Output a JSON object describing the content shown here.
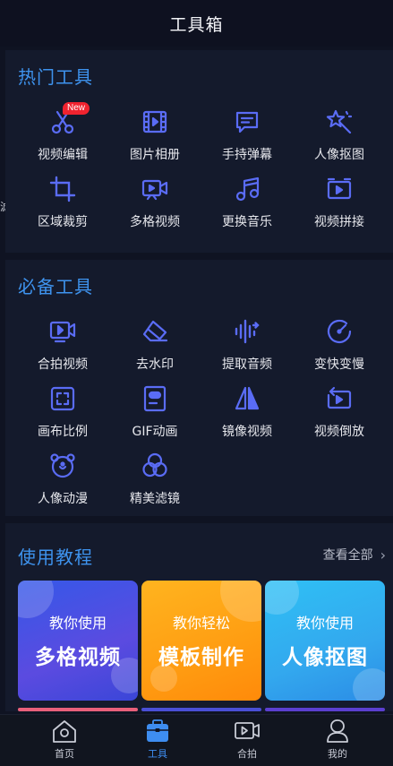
{
  "header": {
    "title": "工具箱"
  },
  "hot": {
    "title": "热门工具",
    "badge": "New",
    "items": [
      {
        "label": "视频编辑",
        "icon": "scissors-icon"
      },
      {
        "label": "图片相册",
        "icon": "film-icon"
      },
      {
        "label": "手持弹幕",
        "icon": "message-icon"
      },
      {
        "label": "人像抠图",
        "icon": "magic-star-icon"
      },
      {
        "label": "区域裁剪",
        "icon": "crop-icon"
      },
      {
        "label": "多格视频",
        "icon": "video-camera-icon"
      },
      {
        "label": "更换音乐",
        "icon": "music-note-icon"
      },
      {
        "label": "视频拼接",
        "icon": "video-join-icon"
      }
    ]
  },
  "essential": {
    "title": "必备工具",
    "items": [
      {
        "label": "合拍视频",
        "icon": "duet-camera-icon"
      },
      {
        "label": "去水印",
        "icon": "eraser-icon"
      },
      {
        "label": "提取音频",
        "icon": "audio-wave-icon"
      },
      {
        "label": "变快变慢",
        "icon": "speed-gauge-icon"
      },
      {
        "label": "画布比例",
        "icon": "canvas-ratio-icon"
      },
      {
        "label": "GIF动画",
        "icon": "gif-icon"
      },
      {
        "label": "镜像视频",
        "icon": "mirror-icon"
      },
      {
        "label": "视频倒放",
        "icon": "reverse-icon"
      },
      {
        "label": "人像动漫",
        "icon": "bear-face-icon"
      },
      {
        "label": "精美滤镜",
        "icon": "filter-circles-icon"
      }
    ]
  },
  "tutorials": {
    "title": "使用教程",
    "see_all": "查看全部",
    "cards": [
      {
        "line1": "教你使用",
        "line2": "多格视频"
      },
      {
        "line1": "教你轻松",
        "line2": "模板制作"
      },
      {
        "line1": "教你使用",
        "line2": "人像抠图"
      }
    ]
  },
  "nav": {
    "items": [
      {
        "label": "首页",
        "icon": "home-icon"
      },
      {
        "label": "工具",
        "icon": "toolbox-icon",
        "active": true
      },
      {
        "label": "合拍",
        "icon": "duet-icon"
      },
      {
        "label": "我的",
        "icon": "profile-icon"
      }
    ]
  },
  "colors": {
    "accent": "#3e93ee",
    "icon_stroke": "#5a6cf5",
    "background": "#0f1322",
    "card": "#141a2c",
    "badge": "#f0232f"
  },
  "edge_glyph": "滤"
}
